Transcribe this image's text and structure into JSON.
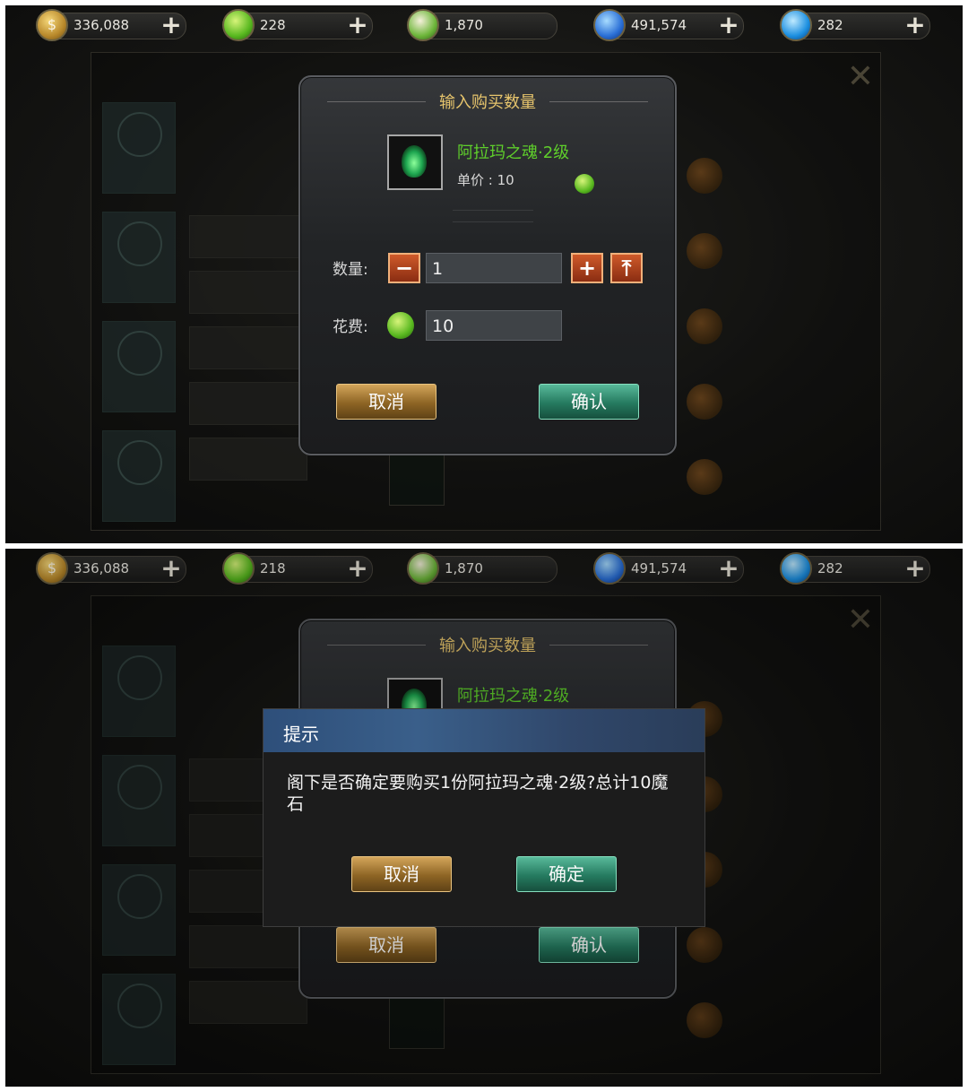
{
  "screens": [
    {
      "currencies": [
        {
          "icon": "gold-coin-icon",
          "value": "336,088"
        },
        {
          "icon": "green-gem-icon",
          "value": "228"
        },
        {
          "icon": "gift-ticket-icon",
          "value": "1,870"
        },
        {
          "icon": "blue-crystal-icon",
          "value": "491,574"
        },
        {
          "icon": "blue-moon-icon",
          "value": "282"
        }
      ],
      "dialog": {
        "title": "输入购买数量",
        "item_name": "阿拉玛之魂·2级",
        "unit_price": "单价 : 10",
        "quantity_label": "数量:",
        "quantity_value": "1",
        "cost_label": "花费:",
        "cost_value": "10",
        "cancel": "取消",
        "confirm": "确认"
      }
    },
    {
      "currencies": [
        {
          "icon": "gold-coin-icon",
          "value": "336,088"
        },
        {
          "icon": "green-gem-icon",
          "value": "218"
        },
        {
          "icon": "gift-ticket-icon",
          "value": "1,870"
        },
        {
          "icon": "blue-crystal-icon",
          "value": "491,574"
        },
        {
          "icon": "blue-moon-icon",
          "value": "282"
        }
      ],
      "dialog": {
        "title": "输入购买数量",
        "item_name": "阿拉玛之魂·2级",
        "cancel": "取消",
        "confirm": "确认"
      },
      "prompt": {
        "title": "提示",
        "message": "阁下是否确定要购买1份阿拉玛之魂·2级?总计10魔石",
        "cancel": "取消",
        "ok": "确定"
      }
    }
  ],
  "colors": {
    "item_name": "#5fcf2b",
    "title_gold": "#e6c46c",
    "cancel_button": "#8d6424",
    "confirm_button": "#257a5f"
  }
}
